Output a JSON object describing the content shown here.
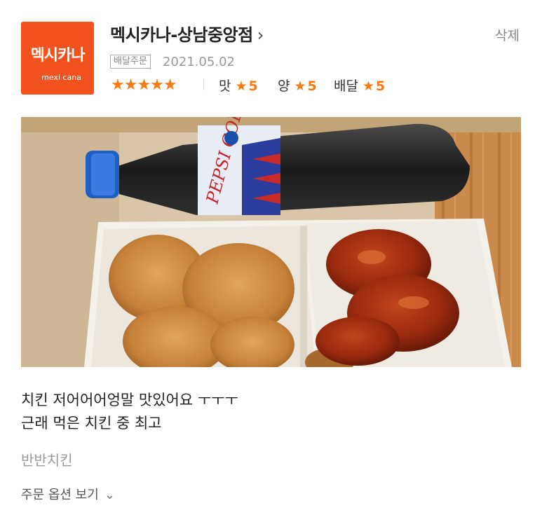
{
  "store": {
    "logo_text": "멕시카나",
    "logo_sub": "mexi cana",
    "name": "멕시카나-상남중앙점",
    "chevron": "›"
  },
  "header": {
    "delete_label": "삭제"
  },
  "order": {
    "type_badge": "배달주문",
    "date": "2021.05.02"
  },
  "ratings": {
    "overall": 5,
    "overall_stars": "★★★★★",
    "taste": {
      "label": "맛",
      "star": "★",
      "value": "5"
    },
    "quantity": {
      "label": "양",
      "star": "★",
      "value": "5"
    },
    "delivery": {
      "label": "배달",
      "star": "★",
      "value": "5"
    }
  },
  "photo": {
    "bottle_label": "PEPSI COLA"
  },
  "review": {
    "line1": "치킨 저어어어엉말 맛있어요 ㅜㅜㅜ",
    "line2": "근래 먹은 치킨 중 최고"
  },
  "menu_item": "반반치킨",
  "options_link": {
    "label": "주문 옵션 보기",
    "chevron": "⌄"
  },
  "colors": {
    "brand": "#f2521e",
    "star": "#f57b12"
  }
}
